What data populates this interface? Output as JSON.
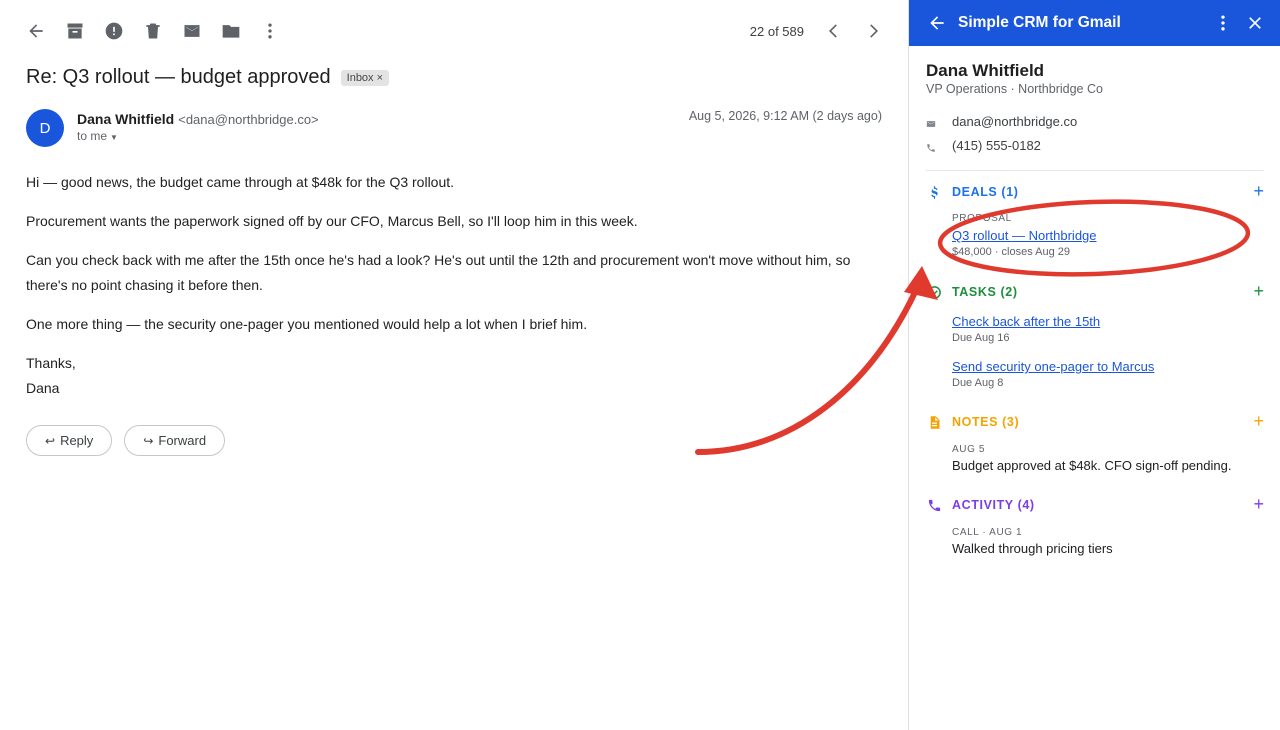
{
  "toolbar": {
    "pager": "22 of 589"
  },
  "email": {
    "subject": "Re: Q3 rollout — budget approved",
    "label": "Inbox",
    "label_close": "×",
    "sender_initial": "D",
    "sender_name": "Dana Whitfield",
    "sender_email": "<dana@northbridge.co>",
    "to": "to me",
    "date": "Aug 5, 2026, 9:12 AM (2 days ago)",
    "body": [
      "Hi — good news, the budget came through at $48k for the Q3 rollout.",
      "Procurement wants the paperwork signed off by our CFO, Marcus Bell, so I'll loop him in this week.",
      "Can you check back with me after the 15th once he's had a look? He's out until the 12th and procurement won't move without him, so there's no point chasing it before then.",
      "One more thing — the security one-pager you mentioned would help a lot when I brief him."
    ],
    "sign_off": "Thanks,",
    "signature": "Dana",
    "reply_label": "Reply",
    "forward_label": "Forward"
  },
  "crm": {
    "title": "Simple CRM for Gmail",
    "contact": {
      "name": "Dana Whitfield",
      "role": "VP Operations · Northbridge Co",
      "email": "dana@northbridge.co",
      "phone": "(415) 555-0182"
    },
    "deals": {
      "title": "DEALS (1)",
      "add": "+",
      "color": "#1a73e8",
      "items": [
        {
          "stage": "PROPOSAL",
          "name": "Q3 rollout — Northbridge",
          "meta": "$48,000 · closes Aug 29"
        }
      ]
    },
    "tasks": {
      "title": "TASKS (2)",
      "add": "+",
      "color": "#1e8e3e",
      "items": [
        {
          "name": "Check back after the 15th",
          "meta": "Due Aug 16"
        },
        {
          "name": "Send security one-pager to Marcus",
          "meta": "Due Aug 8"
        }
      ]
    },
    "notes": {
      "title": "NOTES (3)",
      "add": "+",
      "color": "#f4a300",
      "items": [
        {
          "date": "AUG 5",
          "text": "Budget approved at $48k. CFO sign-off pending."
        }
      ]
    },
    "activity": {
      "title": "ACTIVITY (4)",
      "add": "+",
      "color": "#7b3fe4",
      "items": [
        {
          "type": "CALL · AUG 1",
          "text": "Walked through pricing tiers"
        }
      ]
    }
  },
  "annotation": {
    "color": "#e03a2f"
  }
}
